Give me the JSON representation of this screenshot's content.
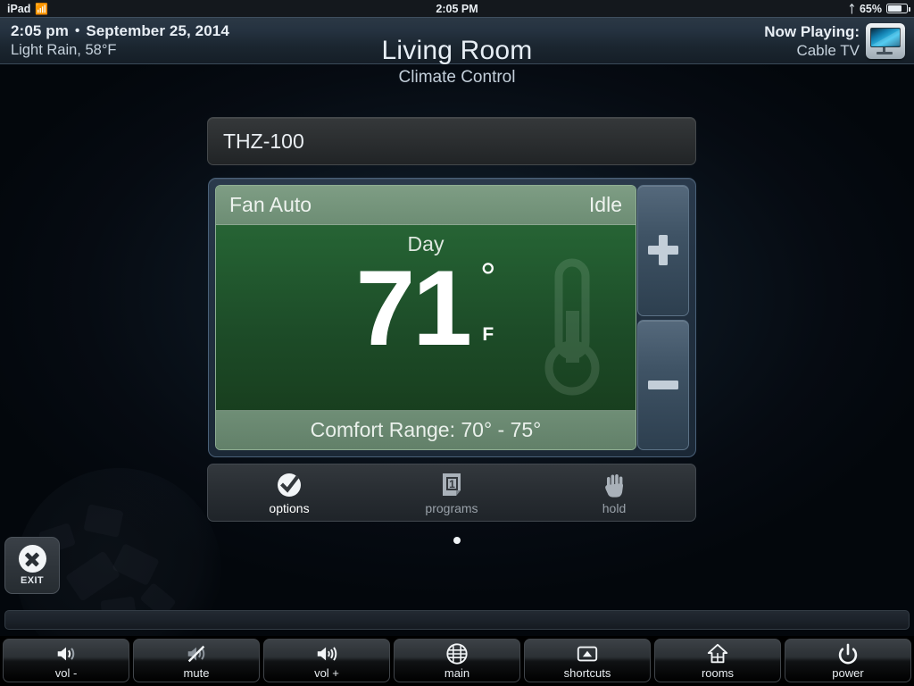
{
  "statusbar": {
    "device": "iPad",
    "wifi_icon": "wifi-icon",
    "time": "2:05 PM",
    "bluetooth_icon": "bluetooth-icon",
    "battery_percent": "65%",
    "battery_level": 65
  },
  "header": {
    "time": "2:05 pm",
    "separator": "•",
    "date": "September 25, 2014",
    "weather": "Light Rain, 58°F",
    "room_title": "Living Room",
    "now_playing_label": "Now Playing:",
    "now_playing_source": "Cable TV",
    "now_playing_icon": "television-icon"
  },
  "page": {
    "subtitle": "Climate Control"
  },
  "device": {
    "name": "THZ-100"
  },
  "thermostat": {
    "fan_mode": "Fan Auto",
    "system_state": "Idle",
    "schedule_mode": "Day",
    "temperature": "71",
    "degree_symbol": "°",
    "unit": "F",
    "comfort_range": "Comfort Range: 70° - 75°",
    "increase_label": "+",
    "decrease_label": "−",
    "accent_green": "#246032",
    "header_green": "#6d8d74"
  },
  "options_bar": [
    {
      "label": "options",
      "icon": "check-circle-icon",
      "active": true
    },
    {
      "label": "programs",
      "icon": "calendar-page-icon",
      "active": false
    },
    {
      "label": "hold",
      "icon": "hand-icon",
      "active": false
    }
  ],
  "pager": {
    "pages": 1,
    "current": 1
  },
  "exit": {
    "label": "EXIT",
    "icon": "close-circle-icon"
  },
  "toolbar": [
    {
      "label": "vol -",
      "icon": "volume-down-icon"
    },
    {
      "label": "mute",
      "icon": "volume-mute-icon"
    },
    {
      "label": "vol +",
      "icon": "volume-up-icon"
    },
    {
      "label": "main",
      "icon": "grid-circle-icon"
    },
    {
      "label": "shortcuts",
      "icon": "shortcuts-icon"
    },
    {
      "label": "rooms",
      "icon": "house-icon"
    },
    {
      "label": "power",
      "icon": "power-icon"
    }
  ]
}
